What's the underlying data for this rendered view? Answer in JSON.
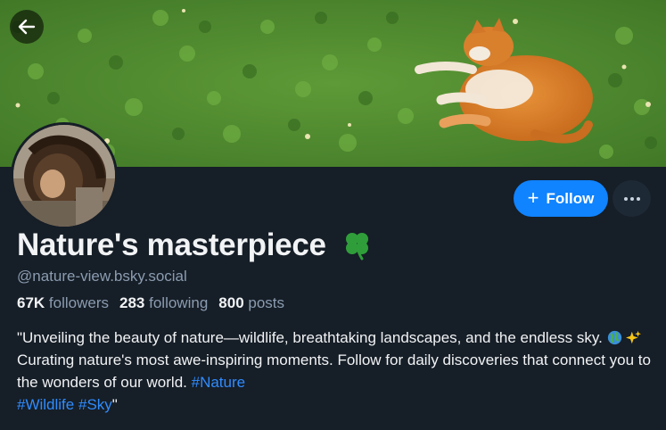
{
  "profile": {
    "display_name": "Nature's masterpiece",
    "name_emoji": "four-leaf-clover",
    "handle": "@nature-view.bsky.social",
    "stats": {
      "followers_count": "67K",
      "followers_label": "followers",
      "following_count": "283",
      "following_label": "following",
      "posts_count": "800",
      "posts_label": "posts"
    },
    "bio": {
      "part1": "\"Unveiling the beauty of nature—wildlife, breathtaking landscapes, and the endless sky. ",
      "emoji1": "globe-icon",
      "emoji2": "sparkles-icon",
      "part2": " Curating nature's most awe-inspiring moments. Follow for daily discoveries that connect you to the wonders of our world. ",
      "tag1": "#Nature",
      "tag2": "#Wildlife",
      "tag3": "#Sky",
      "closing_quote": "\""
    }
  },
  "actions": {
    "follow_plus": "+",
    "follow_label": "Follow",
    "more_icon": "ellipsis-icon",
    "back_icon": "arrow-left-icon"
  },
  "banner": {
    "subject": "orange cat lying on clover"
  },
  "colors": {
    "background": "#161e27",
    "accent": "#1083fe",
    "link": "#2f8cff",
    "muted": "#8b9cb0",
    "text": "#f1f3f5"
  }
}
